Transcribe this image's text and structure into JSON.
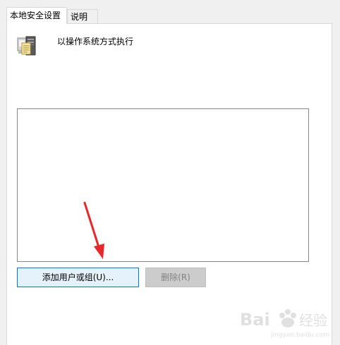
{
  "tabs": [
    {
      "label": "本地安全设置",
      "active": true
    },
    {
      "label": "说明",
      "active": false
    }
  ],
  "policy": {
    "icon": "server-computer-icon",
    "title": "以操作系统方式执行"
  },
  "list": {
    "items": []
  },
  "buttons": {
    "add_label": "添加用户或组(U)...",
    "remove_label": "删除(R)",
    "remove_enabled": false
  },
  "annotation": {
    "color": "#e8262b"
  },
  "watermark": {
    "text": "Bai 经验",
    "sub": "jingyan.baidu.com"
  },
  "colors": {
    "accent": "#0078d7",
    "button_hover_bg": "#e5f1fb",
    "disabled_bg": "#cccccc",
    "panel_border": "#d9d9d9"
  }
}
